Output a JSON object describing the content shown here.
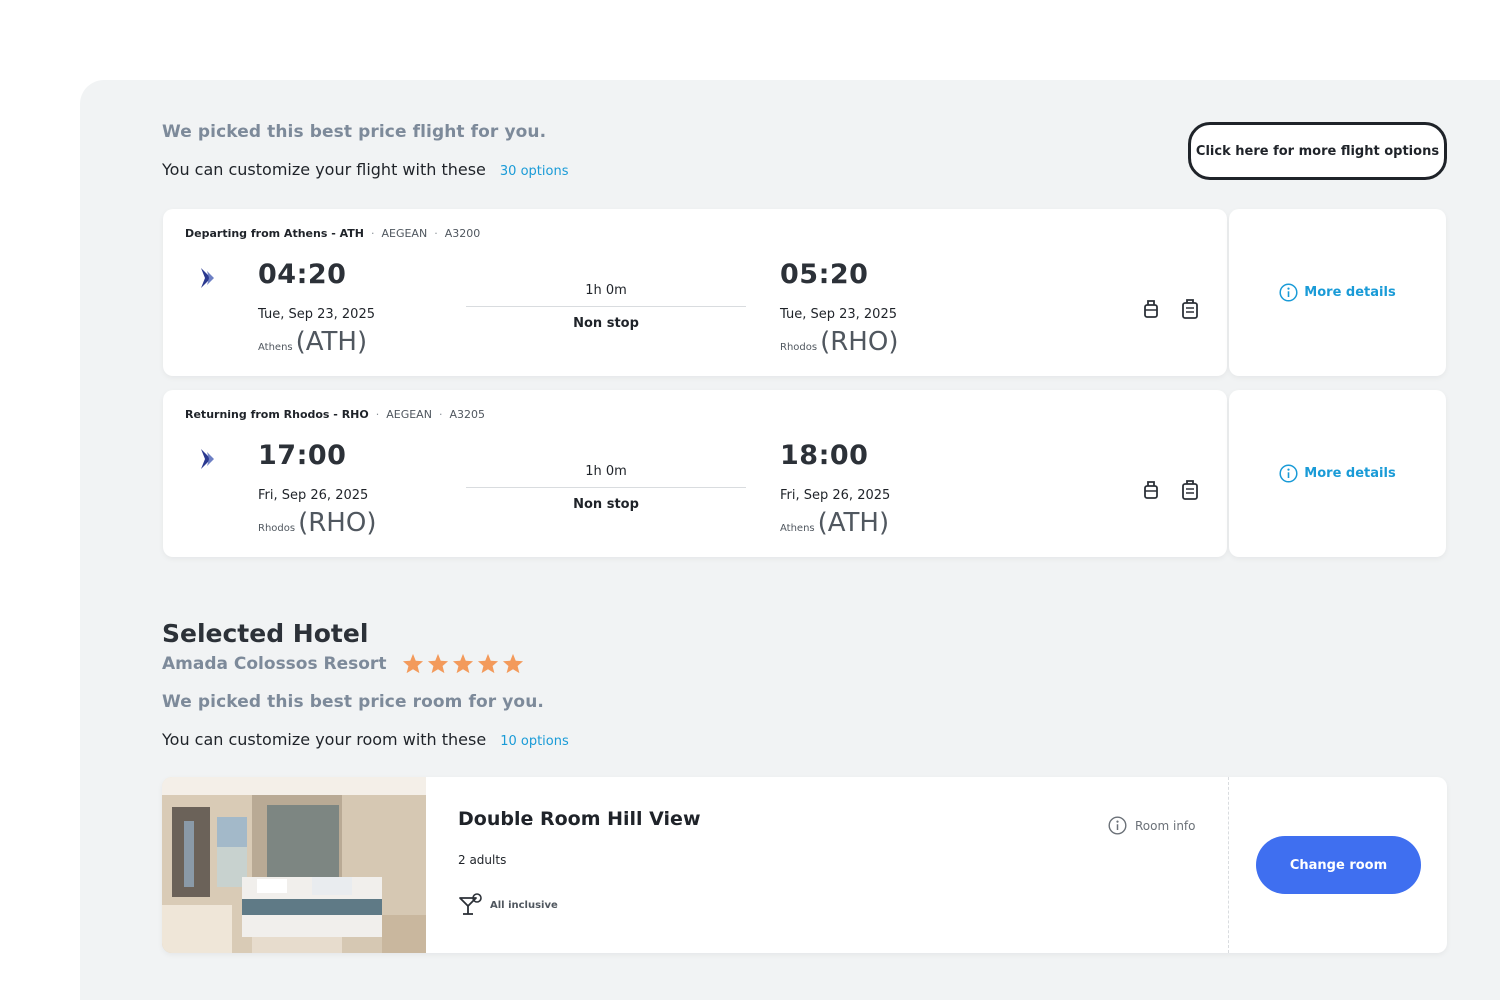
{
  "flights_section": {
    "picked_text": "We picked this best price flight for you.",
    "customize_text": "You can customize your flight with these",
    "options_link": "30 options",
    "more_options_button": "Click here for more flight options"
  },
  "flights": [
    {
      "direction_label": "Departing from Athens - ATH",
      "airline": "AEGEAN",
      "flight_number": "A3200",
      "depart_time": "04:20",
      "depart_date": "Tue, Sep 23, 2025",
      "depart_city": "Athens",
      "depart_code": "(ATH)",
      "duration": "1h 0m",
      "stops": "Non stop",
      "arrive_time": "05:20",
      "arrive_date": "Tue, Sep 23, 2025",
      "arrive_city": "Rhodos",
      "arrive_code": "(RHO)",
      "more_details": "More details"
    },
    {
      "direction_label": "Returning from Rhodos - RHO",
      "airline": "AEGEAN",
      "flight_number": "A3205",
      "depart_time": "17:00",
      "depart_date": "Fri, Sep 26, 2025",
      "depart_city": "Rhodos",
      "depart_code": "(RHO)",
      "duration": "1h 0m",
      "stops": "Non stop",
      "arrive_time": "18:00",
      "arrive_date": "Fri, Sep 26, 2025",
      "arrive_city": "Athens",
      "arrive_code": "(ATH)",
      "more_details": "More details"
    }
  ],
  "hotel_section": {
    "heading": "Selected Hotel",
    "hotel_name": "Amada Colossos Resort",
    "star_rating": 5,
    "picked_text": "We picked this best price room for you.",
    "customize_text": "You can customize your room with these",
    "options_link": "10 options"
  },
  "room": {
    "title": "Double Room Hill View",
    "occupancy": "2 adults",
    "board": "All inclusive",
    "room_info": "Room info",
    "change_button": "Change room"
  },
  "colors": {
    "accent_link": "#1a9bd7",
    "primary_button": "#3f6ff0",
    "star": "#f39a5b",
    "airline_logo": "#2b3990"
  },
  "icons": {
    "airline_logo": "aegean-logo-icon",
    "baggage": "carry-on-bag-icon",
    "checked_baggage": "checked-bag-icon",
    "info": "info-icon",
    "board": "cocktail-icon",
    "star": "star-icon"
  }
}
